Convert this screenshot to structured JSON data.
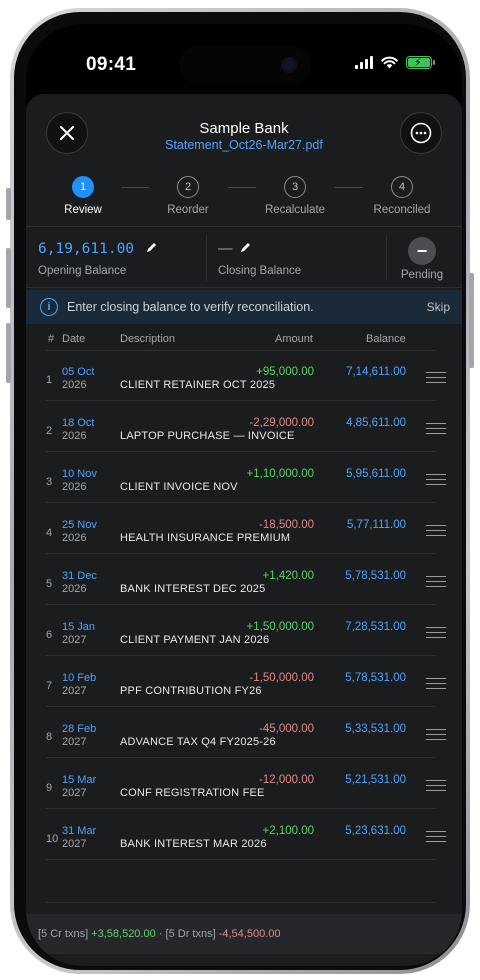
{
  "status": {
    "time": "09:41"
  },
  "header": {
    "title": "Sample Bank",
    "file": "Statement_Oct26-Mar27.pdf"
  },
  "steps": [
    {
      "num": "1",
      "label": "Review"
    },
    {
      "num": "2",
      "label": "Reorder"
    },
    {
      "num": "3",
      "label": "Recalculate"
    },
    {
      "num": "4",
      "label": "Reconciled"
    }
  ],
  "balances": {
    "opening_value": "6,19,611.00",
    "opening_label": "Opening Balance",
    "closing_value": "—",
    "closing_label": "Closing Balance",
    "pending_label": "Pending"
  },
  "info": {
    "text": "Enter closing balance to verify reconciliation.",
    "skip": "Skip"
  },
  "table": {
    "headers": {
      "idx": "#",
      "date": "Date",
      "description": "Description",
      "amount": "Amount",
      "balance": "Balance"
    },
    "rows": [
      {
        "idx": "1",
        "date1": "05 Oct",
        "date2": "2026",
        "desc": "CLIENT RETAINER OCT 2025",
        "amount": "+95,000.00",
        "balance": "7,14,611.00"
      },
      {
        "idx": "2",
        "date1": "18 Oct",
        "date2": "2026",
        "desc": "LAPTOP PURCHASE — INVOICE",
        "amount": "-2,29,000.00",
        "balance": "4,85,611.00"
      },
      {
        "idx": "3",
        "date1": "10 Nov",
        "date2": "2026",
        "desc": "CLIENT INVOICE NOV",
        "amount": "+1,10,000.00",
        "balance": "5,95,611.00"
      },
      {
        "idx": "4",
        "date1": "25 Nov",
        "date2": "2026",
        "desc": "HEALTH INSURANCE PREMIUM",
        "amount": "-18,500.00",
        "balance": "5,77,111.00"
      },
      {
        "idx": "5",
        "date1": "31 Dec",
        "date2": "2026",
        "desc": "BANK INTEREST DEC 2025",
        "amount": "+1,420.00",
        "balance": "5,78,531.00"
      },
      {
        "idx": "6",
        "date1": "15 Jan",
        "date2": "2027",
        "desc": "CLIENT PAYMENT JAN 2026",
        "amount": "+1,50,000.00",
        "balance": "7,28,531.00"
      },
      {
        "idx": "7",
        "date1": "10 Feb",
        "date2": "2027",
        "desc": "PPF CONTRIBUTION FY26",
        "amount": "-1,50,000.00",
        "balance": "5,78,531.00"
      },
      {
        "idx": "8",
        "date1": "28 Feb",
        "date2": "2027",
        "desc": "ADVANCE TAX Q4 FY2025-26",
        "amount": "-45,000.00",
        "balance": "5,33,531.00"
      },
      {
        "idx": "9",
        "date1": "15 Mar",
        "date2": "2027",
        "desc": "CONF REGISTRATION FEE",
        "amount": "-12,000.00",
        "balance": "5,21,531.00"
      },
      {
        "idx": "10",
        "date1": "31 Mar",
        "date2": "2027",
        "desc": "BANK INTEREST MAR 2026",
        "amount": "+2,100.00",
        "balance": "5,23,631.00"
      }
    ]
  },
  "footer": {
    "cr_label": "[5 Cr txns]",
    "cr_total": "+3,58,520.00",
    "sep": "·",
    "dr_label": "[5 Dr txns]",
    "dr_total": "-4,54,500.00"
  },
  "colors": {
    "accent": "#1e90ff",
    "credit": "#5ed26a",
    "debit": "#e08a8a",
    "battery": "#43c05b"
  }
}
